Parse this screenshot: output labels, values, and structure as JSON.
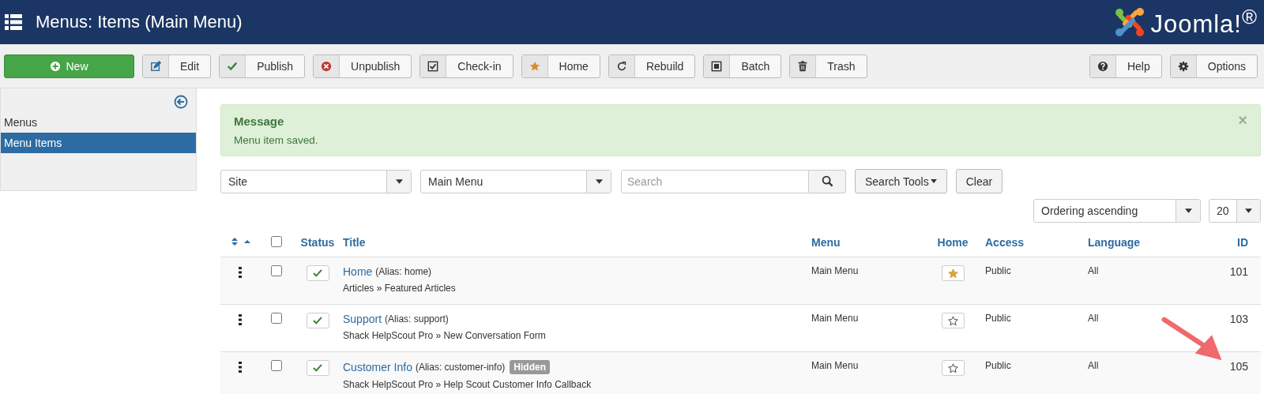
{
  "header": {
    "title": "Menus: Items (Main Menu)",
    "logo_text": "Joomla!$^{®}$"
  },
  "toolbar": {
    "left": [
      {
        "label": "New",
        "kind": "new"
      },
      {
        "label": "Edit",
        "kind": "edit"
      },
      {
        "label": "Publish",
        "kind": "publish"
      },
      {
        "label": "Unpublish",
        "kind": "unpublish"
      },
      {
        "label": "Check-in",
        "kind": "checkin"
      },
      {
        "label": "Home",
        "kind": "home"
      },
      {
        "label": "Rebuild",
        "kind": "rebuild"
      },
      {
        "label": "Batch",
        "kind": "batch"
      },
      {
        "label": "Trash",
        "kind": "trash"
      }
    ],
    "right": [
      {
        "label": "Help",
        "kind": "help"
      },
      {
        "label": "Options",
        "kind": "options"
      }
    ]
  },
  "sidebar": {
    "items": [
      {
        "label": "Menus",
        "selected": false
      },
      {
        "label": "Menu Items",
        "selected": true
      }
    ]
  },
  "message": {
    "heading": "Message",
    "text": "Menu item saved.",
    "close": "×"
  },
  "filters": {
    "client": "Site",
    "menu": "Main Menu",
    "search_placeholder": "Search",
    "search_tools": "Search Tools",
    "clear": "Clear",
    "ordering": "Ordering ascending",
    "limit": "20"
  },
  "table": {
    "columns": [
      "Status",
      "Title",
      "Menu",
      "Home",
      "Access",
      "Language",
      "ID"
    ],
    "select_all_checked": false,
    "rows": [
      {
        "checked": false,
        "published": true,
        "title": "Home",
        "alias": "(Alias: home)",
        "badge": "",
        "subtitle": "Articles » Featured Articles",
        "menu": "Main Menu",
        "home": true,
        "access": "Public",
        "language": "All",
        "id": "101"
      },
      {
        "checked": false,
        "published": true,
        "title": "Support",
        "alias": "(Alias: support)",
        "badge": "",
        "subtitle": "Shack HelpScout Pro » New Conversation Form",
        "menu": "Main Menu",
        "home": false,
        "access": "Public",
        "language": "All",
        "id": "103"
      },
      {
        "checked": false,
        "published": true,
        "title": "Customer Info",
        "alias": "(Alias: customer-info)",
        "badge": "Hidden",
        "subtitle": "Shack HelpScout Pro » Help Scout Customer Info Callback",
        "menu": "Main Menu",
        "home": false,
        "access": "Public",
        "language": "All",
        "id": "105"
      }
    ]
  }
}
